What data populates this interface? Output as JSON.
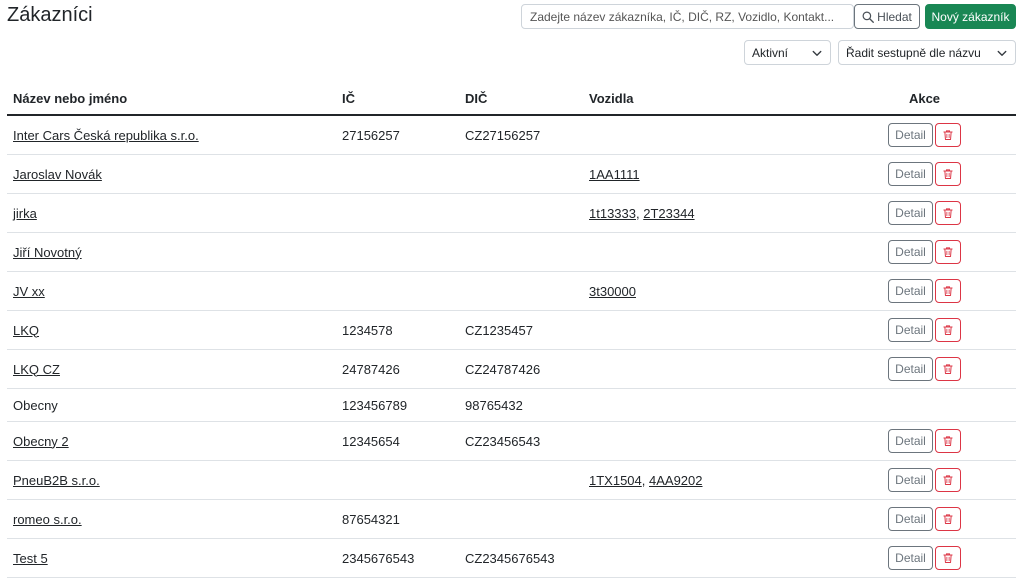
{
  "header": {
    "title": "Zákazníci",
    "search_placeholder": "Zadejte název zákazníka, IČ, DIČ, RZ, Vozidlo, Kontakt...",
    "search_button": "Hledat",
    "new_button": "Nový zákazník"
  },
  "filters": {
    "status": "Aktivní",
    "sort": "Řadit sestupně dle názvu"
  },
  "table": {
    "columns": [
      "Název nebo jméno",
      "IČ",
      "DIČ",
      "Vozidla",
      "Akce"
    ],
    "detail_label": "Detail",
    "rows": [
      {
        "name": "Inter Cars Česká republika s.r.o.",
        "name_link": true,
        "ic": "27156257",
        "dic": "CZ27156257",
        "vehicles": [],
        "actions": true
      },
      {
        "name": "Jaroslav Novák",
        "name_link": true,
        "ic": "",
        "dic": "",
        "vehicles": [
          "1AA1111"
        ],
        "actions": true
      },
      {
        "name": "jirka",
        "name_link": true,
        "ic": "",
        "dic": "",
        "vehicles": [
          "1t13333",
          "2T23344"
        ],
        "actions": true
      },
      {
        "name": "Jiří Novotný",
        "name_link": true,
        "ic": "",
        "dic": "",
        "vehicles": [],
        "actions": true
      },
      {
        "name": "JV xx",
        "name_link": true,
        "ic": "",
        "dic": "",
        "vehicles": [
          "3t30000"
        ],
        "actions": true
      },
      {
        "name": "LKQ",
        "name_link": true,
        "ic": "1234578",
        "dic": "CZ1235457",
        "vehicles": [],
        "actions": true
      },
      {
        "name": "LKQ CZ",
        "name_link": true,
        "ic": "24787426",
        "dic": "CZ24787426",
        "vehicles": [],
        "actions": true
      },
      {
        "name": "Obecny",
        "name_link": false,
        "ic": "123456789",
        "dic": "98765432",
        "vehicles": [],
        "actions": false
      },
      {
        "name": "Obecny 2",
        "name_link": true,
        "ic": "12345654",
        "dic": "CZ23456543",
        "vehicles": [],
        "actions": true
      },
      {
        "name": "PneuB2B s.r.o.",
        "name_link": true,
        "ic": "",
        "dic": "",
        "vehicles": [
          "1TX1504",
          "4AA9202"
        ],
        "actions": true
      },
      {
        "name": "romeo s.r.o.",
        "name_link": true,
        "ic": "87654321",
        "dic": "",
        "vehicles": [],
        "actions": true
      },
      {
        "name": "Test 5",
        "name_link": true,
        "ic": "2345676543",
        "dic": "CZ2345676543",
        "vehicles": [],
        "actions": true
      }
    ]
  },
  "icons": {
    "search": "search-icon",
    "trash": "trash-icon",
    "chevron": "chevron-down-icon"
  },
  "colors": {
    "primary_green": "#198754",
    "danger_red": "#dc3545",
    "secondary": "#6c757d"
  }
}
